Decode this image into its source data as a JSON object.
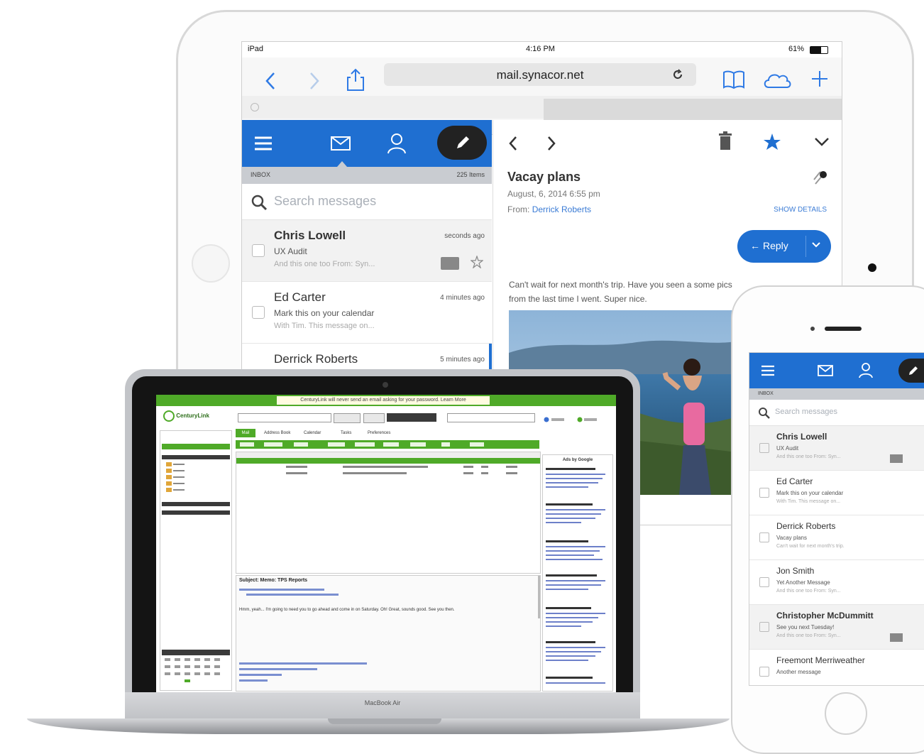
{
  "ipad": {
    "status": {
      "carrier": "iPad",
      "time": "4:16 PM",
      "battery": "61%"
    },
    "safari": {
      "url": "mail.synacor.net"
    },
    "mail": {
      "inbox_label": "INBOX",
      "inbox_count": "225 Items",
      "search_placeholder": "Search messages",
      "messages": [
        {
          "from": "Chris Lowell",
          "subject": "UX Audit",
          "preview": "And this one too From: Syn...",
          "time": "seconds ago"
        },
        {
          "from": "Ed Carter",
          "subject": "Mark this on your calendar",
          "preview": "With Tim. This message on...",
          "time": "4 minutes ago"
        },
        {
          "from": "Derrick Roberts",
          "subject": "",
          "preview": "",
          "time": "5 minutes ago"
        }
      ],
      "reader": {
        "subject": "Vacay plans",
        "date": "August, 6, 2014 6:55 pm",
        "from_label": "From:",
        "from_name": "Derrick Roberts",
        "show_details": "SHOW DETAILS",
        "reply_label": "Reply",
        "body": "Can't wait for next month's trip. Have you seen a some pics from the last time I went. Super nice."
      }
    }
  },
  "macbook": {
    "model": "MacBook Air",
    "banner": "CenturyLink will never send an email asking for your password. Learn More",
    "brand": "CenturyLink",
    "tabs": [
      "Mail",
      "Address Book",
      "Calendar",
      "Tasks",
      "Preferences"
    ],
    "reading_subject": "Subject: Memo: TPS Reports",
    "reading_body": "Hmm, yeah... I'm going to need you to go ahead and come in on Saturday. Oh! Great, sounds good. See you then.",
    "sidebar_header": "Ads by Google"
  },
  "iphone": {
    "inbox_label": "INBOX",
    "search_placeholder": "Search messages",
    "messages": [
      {
        "from": "Chris Lowell",
        "subject": "UX Audit",
        "preview": "And this one too From: Syn..."
      },
      {
        "from": "Ed Carter",
        "subject": "Mark this on your calendar",
        "preview": "With Tim. This message on..."
      },
      {
        "from": "Derrick Roberts",
        "subject": "Vacay plans",
        "preview": "Can't wait for next month's trip."
      },
      {
        "from": "Jon Smith",
        "subject": "Yet Another Message",
        "preview": "And this one too From: Syn..."
      },
      {
        "from": "Christopher McDummitt",
        "subject": "See you next Tuesday!",
        "preview": "And this one too From: Syn..."
      },
      {
        "from": "Freemont Merriweather",
        "subject": "Another message",
        "preview": ""
      }
    ]
  },
  "colors": {
    "brand_blue": "#1f6fd1",
    "centurylink_green": "#4faa28"
  }
}
